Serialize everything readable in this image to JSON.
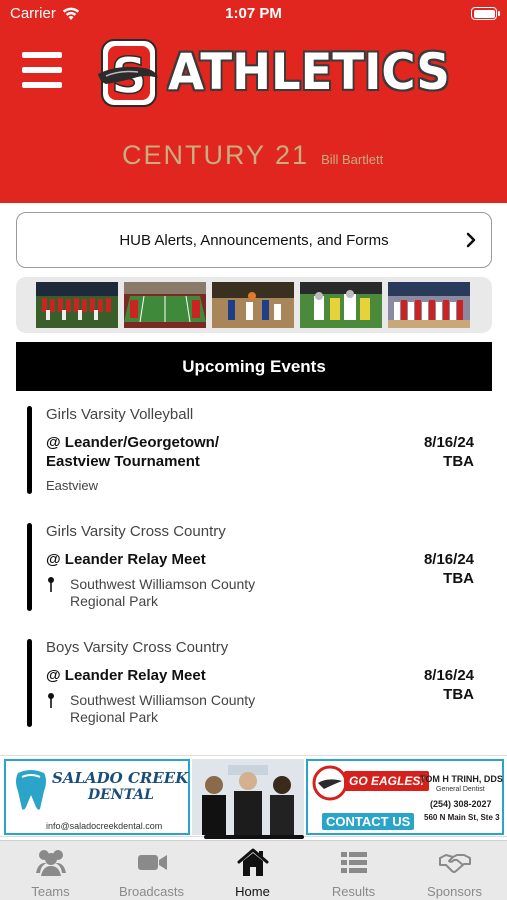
{
  "status_bar": {
    "carrier": "Carrier",
    "time": "1:07 PM"
  },
  "header": {
    "title": "ATHLETICS",
    "sponsor_brand": "CENTURY 21",
    "sponsor_agent": "Bill Bartlett",
    "brand_color": "#e1251f",
    "logo_letter": "S"
  },
  "hub": {
    "label": "HUB Alerts, Announcements, and Forms"
  },
  "photos": [
    "Team group photo on field",
    "Football stadium",
    "Basketball game",
    "Football game action",
    "Volleyball team photo"
  ],
  "events_title": "Upcoming Events",
  "events": [
    {
      "team": "Girls Varsity Volleyball",
      "name_line1": "@ Leander/Georgetown/",
      "name_line2": "Eastview Tournament",
      "date": "8/16/24",
      "time": "TBA",
      "location": "Eastview"
    },
    {
      "team": "Girls Varsity Cross Country",
      "name_line1": "@ Leander Relay Meet",
      "date": "8/16/24",
      "time": "TBA",
      "address_line1": "Southwest Williamson County",
      "address_line2": "Regional Park"
    },
    {
      "team": "Boys Varsity Cross Country",
      "name_line1": "@ Leander Relay Meet",
      "date": "8/16/24",
      "time": "TBA",
      "address_line1": "Southwest Williamson County",
      "address_line2": "Regional Park"
    }
  ],
  "ad": {
    "brand_line1": "SALADO CREEK",
    "brand_line2": "DENTAL",
    "email": "info@saladocreekdental.com",
    "slogan": "GO EAGLES!",
    "cta": "CONTACT US",
    "dentist_name": "TOM H TRINH, DDS",
    "dentist_title": "General Dentist",
    "phone": "(254) 308-2027",
    "address": "560 N Main St, Ste 3"
  },
  "tabs": [
    {
      "label": "Teams",
      "icon": "teams-icon"
    },
    {
      "label": "Broadcasts",
      "icon": "video-camera-icon"
    },
    {
      "label": "Home",
      "icon": "home-icon",
      "active": true
    },
    {
      "label": "Results",
      "icon": "list-icon"
    },
    {
      "label": "Sponsors",
      "icon": "handshake-icon"
    }
  ]
}
